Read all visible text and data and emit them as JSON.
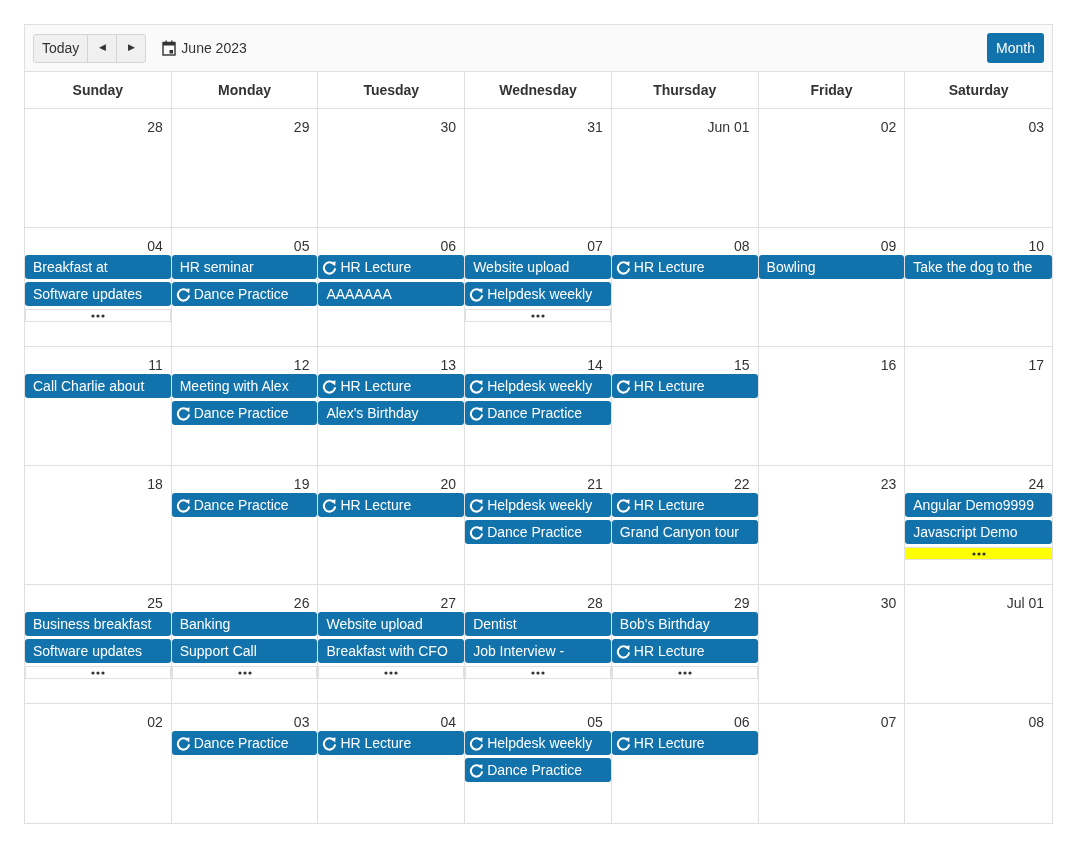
{
  "toolbar": {
    "today": "Today",
    "prev": "◀",
    "next": "▶",
    "title": "June 2023",
    "view": "Month"
  },
  "weekdays": [
    "Sunday",
    "Monday",
    "Tuesday",
    "Wednesday",
    "Thursday",
    "Friday",
    "Saturday"
  ],
  "weeks": [
    [
      {
        "date": "28"
      },
      {
        "date": "29"
      },
      {
        "date": "30"
      },
      {
        "date": "31"
      },
      {
        "date": "Jun 01"
      },
      {
        "date": "02"
      },
      {
        "date": "03"
      }
    ],
    [
      {
        "date": "04",
        "events": [
          {
            "title": "Breakfast at",
            "recurring": false
          },
          {
            "title": "Software updates",
            "recurring": false
          }
        ],
        "more": true
      },
      {
        "date": "05",
        "events": [
          {
            "title": "HR seminar",
            "recurring": false
          },
          {
            "title": "Dance Practice",
            "recurring": true
          }
        ]
      },
      {
        "date": "06",
        "events": [
          {
            "title": "HR Lecture",
            "recurring": true
          },
          {
            "title": "AAAAAAA",
            "recurring": false
          }
        ]
      },
      {
        "date": "07",
        "events": [
          {
            "title": "Website upload",
            "recurring": false
          },
          {
            "title": "Helpdesk weekly",
            "recurring": true
          }
        ],
        "more": true
      },
      {
        "date": "08",
        "events": [
          {
            "title": "HR Lecture",
            "recurring": true
          }
        ]
      },
      {
        "date": "09",
        "events": [
          {
            "title": "Bowling",
            "recurring": false
          }
        ]
      },
      {
        "date": "10",
        "events": [
          {
            "title": "Take the dog to the",
            "recurring": false
          }
        ]
      }
    ],
    [
      {
        "date": "11",
        "events": [
          {
            "title": "Call Charlie about",
            "recurring": false
          }
        ]
      },
      {
        "date": "12",
        "events": [
          {
            "title": "Meeting with Alex",
            "recurring": false
          },
          {
            "title": "Dance Practice",
            "recurring": true
          }
        ]
      },
      {
        "date": "13",
        "events": [
          {
            "title": "HR Lecture",
            "recurring": true
          },
          {
            "title": "Alex's Birthday",
            "recurring": false
          }
        ]
      },
      {
        "date": "14",
        "events": [
          {
            "title": "Helpdesk weekly",
            "recurring": true
          },
          {
            "title": "Dance Practice",
            "recurring": true
          }
        ]
      },
      {
        "date": "15",
        "events": [
          {
            "title": "HR Lecture",
            "recurring": true
          }
        ]
      },
      {
        "date": "16"
      },
      {
        "date": "17"
      }
    ],
    [
      {
        "date": "18"
      },
      {
        "date": "19",
        "events": [
          {
            "title": "Dance Practice",
            "recurring": true
          }
        ]
      },
      {
        "date": "20",
        "events": [
          {
            "title": "HR Lecture",
            "recurring": true
          }
        ]
      },
      {
        "date": "21",
        "events": [
          {
            "title": "Helpdesk weekly",
            "recurring": true
          },
          {
            "title": "Dance Practice",
            "recurring": true
          }
        ]
      },
      {
        "date": "22",
        "events": [
          {
            "title": "HR Lecture",
            "recurring": true
          },
          {
            "title": "Grand Canyon tour",
            "recurring": false
          }
        ]
      },
      {
        "date": "23"
      },
      {
        "date": "24",
        "events": [
          {
            "title": "Angular Demo9999",
            "recurring": false
          },
          {
            "title": "Javascript Demo",
            "recurring": false
          }
        ],
        "more": true,
        "highlighted": true
      }
    ],
    [
      {
        "date": "25",
        "events": [
          {
            "title": "Business breakfast",
            "recurring": false
          },
          {
            "title": "Software updates",
            "recurring": false
          }
        ],
        "more": true
      },
      {
        "date": "26",
        "events": [
          {
            "title": "Banking",
            "recurring": false
          },
          {
            "title": "Support Call",
            "recurring": false
          }
        ],
        "more": true
      },
      {
        "date": "27",
        "events": [
          {
            "title": "Website upload",
            "recurring": false
          },
          {
            "title": "Breakfast with CFO",
            "recurring": false
          }
        ],
        "more": true
      },
      {
        "date": "28",
        "events": [
          {
            "title": "Dentist",
            "recurring": false
          },
          {
            "title": "Job Interview -",
            "recurring": false
          }
        ],
        "more": true
      },
      {
        "date": "29",
        "events": [
          {
            "title": "Bob's Birthday",
            "recurring": false
          },
          {
            "title": "HR Lecture",
            "recurring": true
          }
        ],
        "more": true
      },
      {
        "date": "30"
      },
      {
        "date": "Jul 01"
      }
    ],
    [
      {
        "date": "02"
      },
      {
        "date": "03",
        "events": [
          {
            "title": "Dance Practice",
            "recurring": true
          }
        ]
      },
      {
        "date": "04",
        "events": [
          {
            "title": "HR Lecture",
            "recurring": true
          }
        ]
      },
      {
        "date": "05",
        "events": [
          {
            "title": "Helpdesk weekly",
            "recurring": true
          },
          {
            "title": "Dance Practice",
            "recurring": true
          }
        ]
      },
      {
        "date": "06",
        "events": [
          {
            "title": "HR Lecture",
            "recurring": true
          }
        ]
      },
      {
        "date": "07"
      },
      {
        "date": "08"
      }
    ]
  ]
}
